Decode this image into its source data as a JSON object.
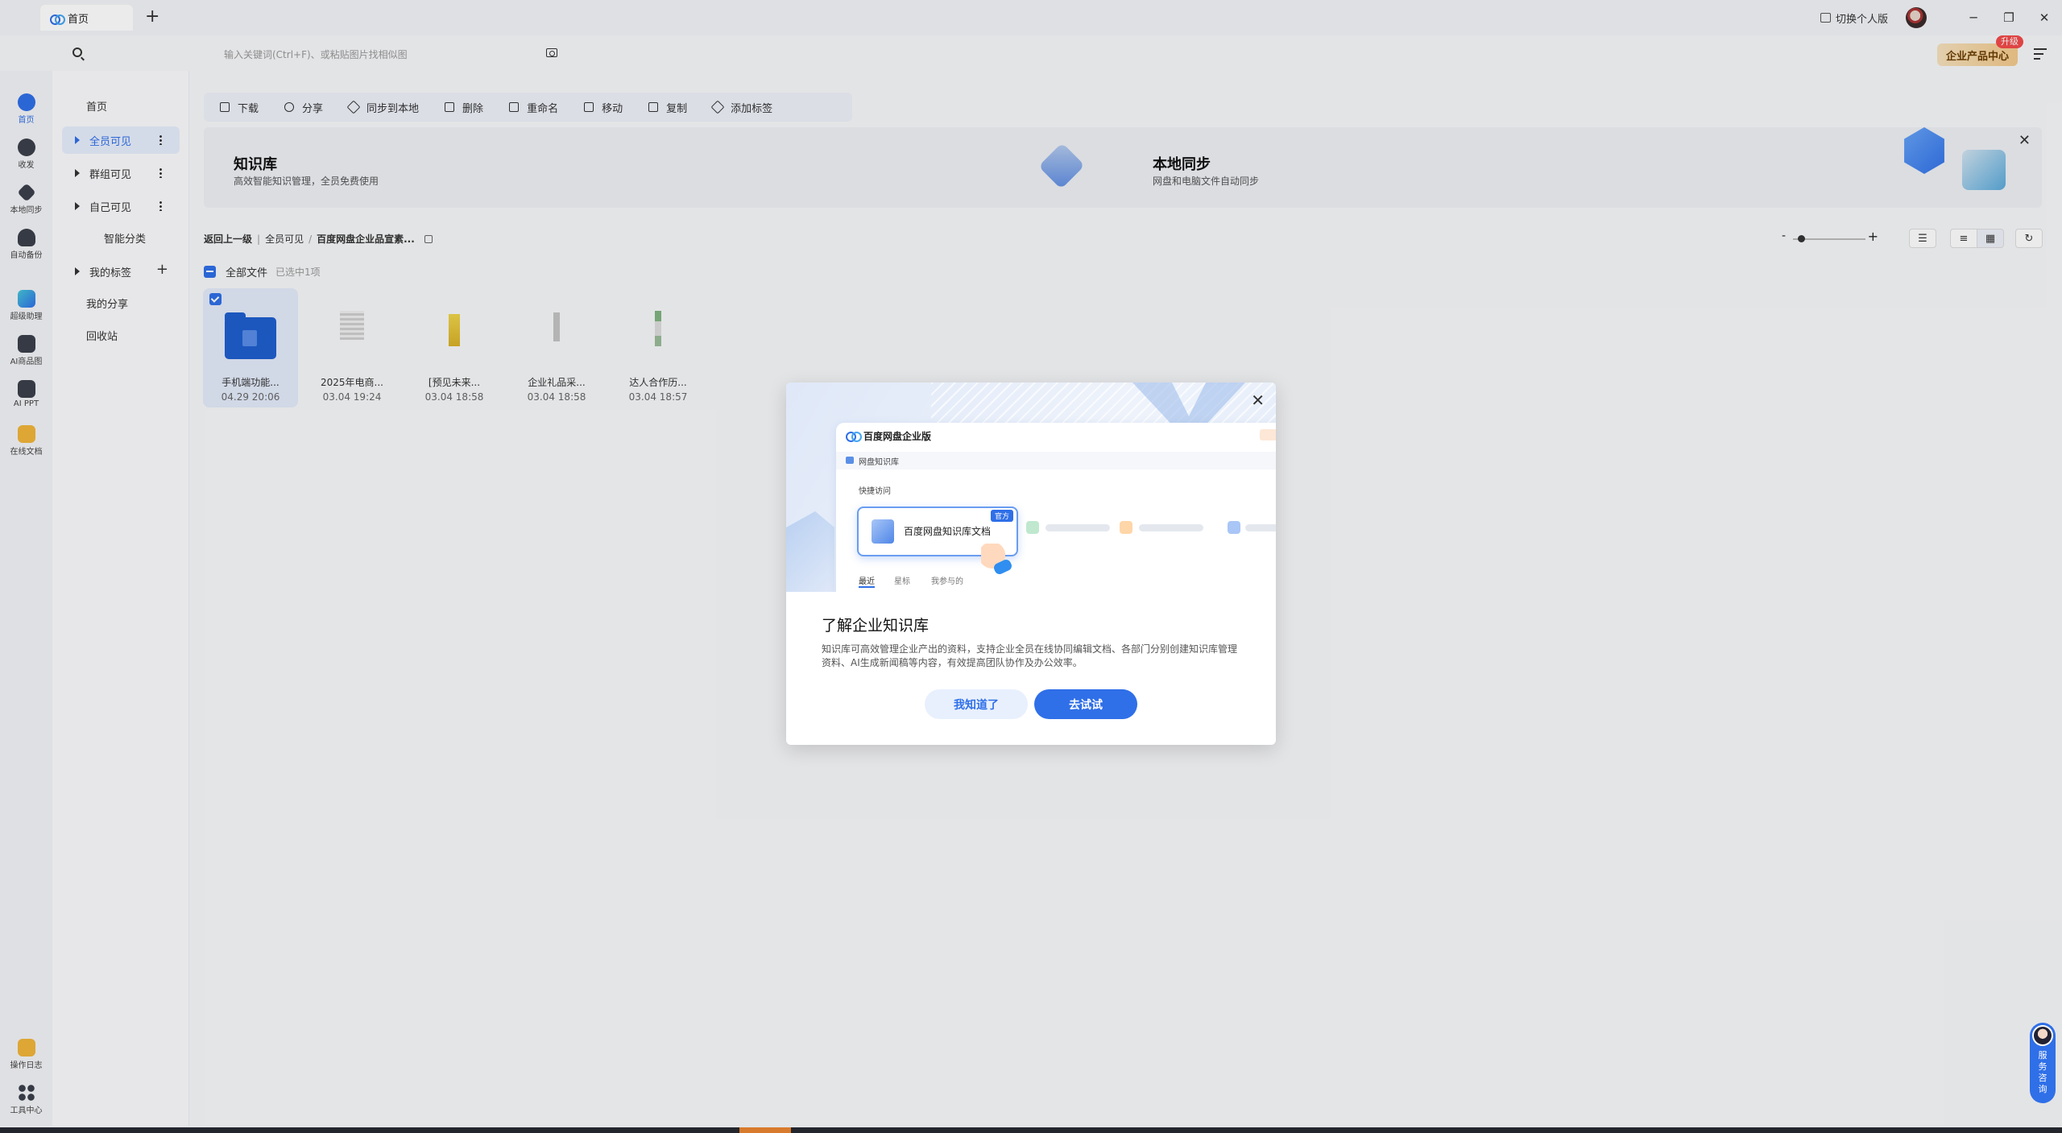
{
  "titlebar": {
    "tab_label": "首页",
    "tab_add": "+",
    "switch_personal": "切换个人版",
    "min": "─",
    "restore": "❐",
    "close": "✕"
  },
  "search": {
    "placeholder": "输入关键词(Ctrl+F)、或粘贴图片找相似图"
  },
  "enterprise": {
    "label": "企业产品中心",
    "badge": "升级"
  },
  "rail": [
    {
      "label": "首页"
    },
    {
      "label": "收发"
    },
    {
      "label": "本地同步"
    },
    {
      "label": "自动备份"
    },
    {
      "label": "超级助理"
    },
    {
      "label": "AI商品图"
    },
    {
      "label": "AI PPT"
    },
    {
      "label": "在线文档"
    },
    {
      "label": "操作日志"
    },
    {
      "label": "工具中心"
    }
  ],
  "sidebar": {
    "home": "首页",
    "items": [
      {
        "label": "全员可见"
      },
      {
        "label": "群组可见"
      },
      {
        "label": "自己可见"
      },
      {
        "label": "智能分类"
      },
      {
        "label": "我的标签"
      },
      {
        "label": "我的分享"
      },
      {
        "label": "回收站"
      }
    ]
  },
  "toolbar": {
    "items": [
      "下载",
      "分享",
      "同步到本地",
      "删除",
      "重命名",
      "移动",
      "复制",
      "添加标签"
    ]
  },
  "banner": {
    "kb_title": "知识库",
    "kb_sub": "高效智能知识管理，全员免费使用",
    "sync_title": "本地同步",
    "sync_sub": "网盘和电脑文件自动同步",
    "close": "✕"
  },
  "breadcrumb": {
    "back": "返回上一级",
    "level1": "全员可见",
    "sep": "/",
    "current": "百度网盘企业品宣素..."
  },
  "files_header": {
    "all": "全部文件",
    "selected": "已选中1项"
  },
  "files": [
    {
      "name": "手机端功能...",
      "date": "04.29 20:06",
      "selected": true
    },
    {
      "name": "2025年电商...",
      "date": "03.04 19:24"
    },
    {
      "name": "[预见未来...",
      "date": "03.04 18:58"
    },
    {
      "name": "企业礼品采...",
      "date": "03.04 18:58"
    },
    {
      "name": "达人合作历...",
      "date": "03.04 18:57"
    }
  ],
  "modal": {
    "close": "✕",
    "card_title": "百度网盘企业版",
    "card_nav": "网盘知识库",
    "quick_access": "快捷访问",
    "tile_title": "百度网盘知识库文档",
    "tile_tag": "官方",
    "tabs": [
      "最近",
      "星标",
      "我参与的"
    ],
    "title": "了解企业知识库",
    "desc": "知识库可高效管理企业产出的资料，支持企业全员在线协同编辑文档、各部门分别创建知识库管理资料、AI生成新闻稿等内容，有效提高团队协作及办公效率。",
    "btn_know": "我知道了",
    "btn_try": "去试试"
  },
  "service": {
    "label": "服务咨询"
  },
  "colors": {
    "accent": "#2f6fe8",
    "enterprise_gold": "#f2c98b",
    "badge_red": "#f24a4a"
  }
}
